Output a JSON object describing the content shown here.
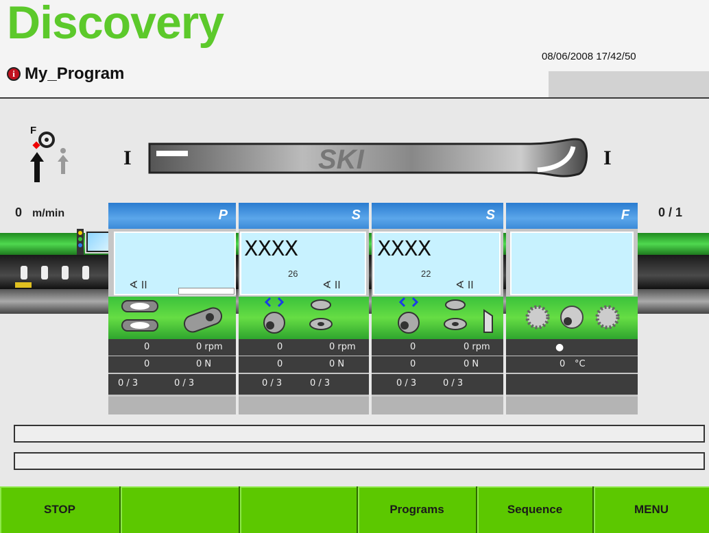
{
  "header": {
    "app_title": "Discovery",
    "program_name": "My_Program",
    "datetime": "08/06/2008 17/42/50"
  },
  "machine": {
    "indicator_label": "F",
    "bracket_left": "I",
    "bracket_right": "I",
    "ski_text": "SKI",
    "speed_value": "0",
    "speed_unit": "m/min",
    "count": "0 / 1"
  },
  "stations": [
    {
      "letter": "P",
      "screen_text": "",
      "screen_num": "",
      "angle": "∢ II",
      "row1": {
        "left": "0",
        "right": "0  rpm"
      },
      "row2": {
        "left": "0",
        "right": "0  N"
      },
      "row3": {
        "left": "0 / 3",
        "right": "0 / 3"
      }
    },
    {
      "letter": "S",
      "screen_text": "XXXX",
      "screen_num": "26",
      "angle": "∢ II",
      "row1": {
        "left": "0",
        "right": "0  rpm"
      },
      "row2": {
        "left": "0",
        "right": "0  N"
      },
      "row3": {
        "left": "0 / 3",
        "right": "0 / 3"
      }
    },
    {
      "letter": "S",
      "screen_text": "XXXX",
      "screen_num": "22",
      "angle": "∢ II",
      "row1": {
        "left": "0",
        "right": "0  rpm"
      },
      "row2": {
        "left": "0",
        "right": "0  N"
      },
      "row3": {
        "left": "0 / 3",
        "right": "0 / 3"
      }
    },
    {
      "letter": "F",
      "screen_text": "",
      "screen_num": "",
      "angle": "",
      "row1": {
        "left": "●",
        "right": ""
      },
      "row2": {
        "left": "0",
        "right": "°C"
      },
      "row3": {
        "left": "",
        "right": ""
      }
    }
  ],
  "footer": {
    "buttons": [
      "STOP",
      "",
      "",
      "Programs",
      "Sequence",
      "MENU"
    ]
  },
  "colors": {
    "brand_green": "#5cc92b",
    "footer_green": "#5cc800",
    "station_header_blue": "#3b8ad8",
    "screen_cyan": "#c8f2ff"
  }
}
